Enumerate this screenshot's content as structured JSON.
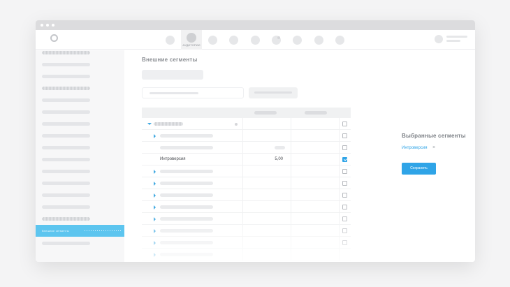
{
  "topnav": {
    "active_item_label": "АУДИТОРИИ"
  },
  "sidebar": {
    "active_item_label": "Внешние сегменты"
  },
  "main": {
    "title": "Внешние сегменты",
    "table": {
      "selected_row_label": "Интроверсия",
      "selected_row_value": "5,00"
    }
  },
  "selected_panel": {
    "title": "Выбранные сегменты",
    "chip_label": "Интроверсия",
    "chip_remove": "×",
    "save_label": "Сохранить"
  },
  "colors": {
    "accent": "#2fa4e7",
    "sidebar_active": "#5dc5ef"
  }
}
